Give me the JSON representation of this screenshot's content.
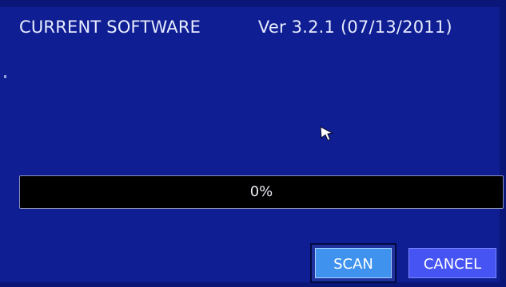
{
  "software": {
    "label": "CURRENT SOFTWARE",
    "version": "Ver 3.2.1 (07/13/2011)"
  },
  "progress": {
    "percent": 0,
    "label": "0%"
  },
  "buttons": {
    "scan": "SCAN",
    "cancel": "CANCEL"
  },
  "colors": {
    "background": "#0f1f93",
    "progress_track": "#000000",
    "progress_fill": "#3d5cff",
    "scan_button": "#3f93ee",
    "cancel_button": "#4554f2"
  },
  "icons": {
    "cursor": "mouse-pointer-icon"
  }
}
